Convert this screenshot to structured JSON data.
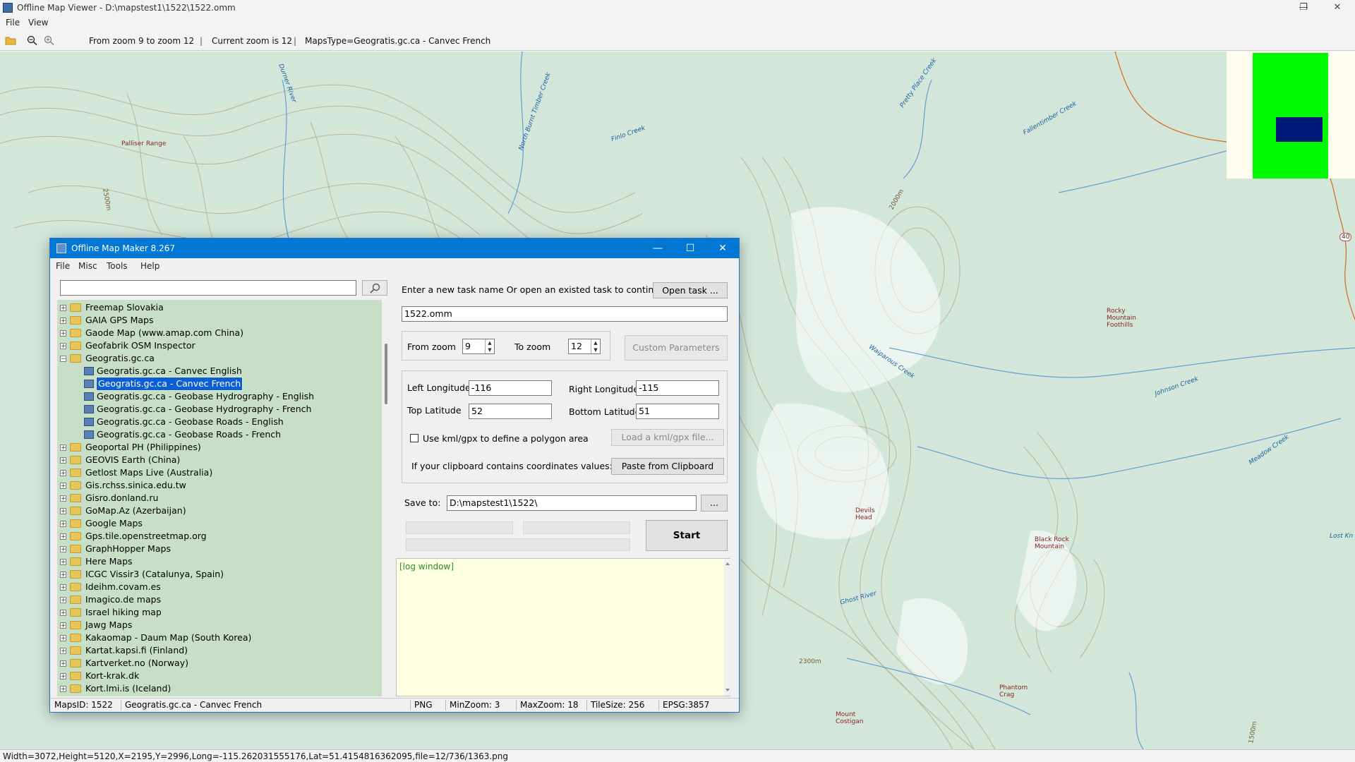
{
  "outer": {
    "title": "Offline Map Viewer - D:\\mapstest1\\1522\\1522.omm",
    "menu": [
      "File",
      "View"
    ],
    "toolbar": {
      "zoom_range": "From zoom 9 to zoom 12",
      "current_zoom": "Current zoom is 12",
      "maps_type": "MapsType=Geogratis.gc.ca - Canvec French"
    },
    "status": "Width=3072,Height=5120,X=2195,Y=2996,Long=-115.262031555176,Lat=51.4154816362095,file=12/736/1363.png"
  },
  "map": {
    "labels": [
      {
        "text": "Palliser Range",
        "kind": "brown"
      },
      {
        "text": "Durner River",
        "kind": "water"
      },
      {
        "text": "North Burnt Timber Creek",
        "kind": "water"
      },
      {
        "text": "Finlo Creek",
        "kind": "water"
      },
      {
        "text": "Pretty Place Creek",
        "kind": "water"
      },
      {
        "text": "Fallentimber Creek",
        "kind": "water"
      },
      {
        "text": "Rocky Mountain Foothills",
        "kind": "brown"
      },
      {
        "text": "Waiparous Creek",
        "kind": "water"
      },
      {
        "text": "Johnson Creek",
        "kind": "water"
      },
      {
        "text": "Devils Head",
        "kind": "brown"
      },
      {
        "text": "Black Rock Mountain",
        "kind": "brown"
      },
      {
        "text": "Ghost River",
        "kind": "water"
      },
      {
        "text": "Meadow Creek",
        "kind": "water"
      },
      {
        "text": "Phantom Crag",
        "kind": "brown"
      },
      {
        "text": "Mount Costigan",
        "kind": "brown"
      },
      {
        "text": "Lost Kn",
        "kind": "water"
      },
      {
        "text": "2500m",
        "kind": "contour"
      },
      {
        "text": "2000m",
        "kind": "contour"
      },
      {
        "text": "2300m",
        "kind": "contour"
      },
      {
        "text": "1500m",
        "kind": "contour"
      },
      {
        "text": "40",
        "kind": "water"
      }
    ]
  },
  "dialog": {
    "title": "Offline Map Maker 8.267",
    "menu": [
      "File",
      "Misc",
      "Tools",
      "Help"
    ],
    "search": {
      "value": "",
      "placeholder": ""
    },
    "tree": [
      {
        "label": "Freemap Slovakia",
        "level": 0,
        "type": "folder",
        "expanded": false
      },
      {
        "label": "GAIA GPS Maps",
        "level": 0,
        "type": "folder",
        "expanded": false
      },
      {
        "label": "Gaode Map (www.amap.com China)",
        "level": 0,
        "type": "folder",
        "expanded": false
      },
      {
        "label": "Geofabrik OSM Inspector",
        "level": 0,
        "type": "folder",
        "expanded": false
      },
      {
        "label": "Geogratis.gc.ca",
        "level": 0,
        "type": "folder",
        "expanded": true
      },
      {
        "label": "Geogratis.gc.ca - Canvec English",
        "level": 1,
        "type": "map"
      },
      {
        "label": "Geogratis.gc.ca - Canvec French",
        "level": 1,
        "type": "map",
        "selected": true
      },
      {
        "label": "Geogratis.gc.ca - Geobase Hydrography - English",
        "level": 1,
        "type": "map"
      },
      {
        "label": "Geogratis.gc.ca - Geobase Hydrography - French",
        "level": 1,
        "type": "map"
      },
      {
        "label": "Geogratis.gc.ca - Geobase Roads - English",
        "level": 1,
        "type": "map"
      },
      {
        "label": "Geogratis.gc.ca - Geobase Roads - French",
        "level": 1,
        "type": "map"
      },
      {
        "label": "Geoportal PH (Philippines)",
        "level": 0,
        "type": "folder",
        "expanded": false
      },
      {
        "label": "GEOVIS Earth (China)",
        "level": 0,
        "type": "folder",
        "expanded": false
      },
      {
        "label": "Getlost Maps Live (Australia)",
        "level": 0,
        "type": "folder",
        "expanded": false
      },
      {
        "label": "Gis.rchss.sinica.edu.tw",
        "level": 0,
        "type": "folder",
        "expanded": false
      },
      {
        "label": "Gisro.donland.ru",
        "level": 0,
        "type": "folder",
        "expanded": false
      },
      {
        "label": "GoMap.Az (Azerbaijan)",
        "level": 0,
        "type": "folder",
        "expanded": false
      },
      {
        "label": "Google Maps",
        "level": 0,
        "type": "folder",
        "expanded": false
      },
      {
        "label": "Gps.tile.openstreetmap.org",
        "level": 0,
        "type": "folder",
        "expanded": false
      },
      {
        "label": "GraphHopper Maps",
        "level": 0,
        "type": "folder",
        "expanded": false
      },
      {
        "label": "Here Maps",
        "level": 0,
        "type": "folder",
        "expanded": false
      },
      {
        "label": "ICGC Vissir3 (Catalunya, Spain)",
        "level": 0,
        "type": "folder",
        "expanded": false
      },
      {
        "label": "Ideihm.covam.es",
        "level": 0,
        "type": "folder",
        "expanded": false
      },
      {
        "label": "Imagico.de maps",
        "level": 0,
        "type": "folder",
        "expanded": false
      },
      {
        "label": "Israel hiking map",
        "level": 0,
        "type": "folder",
        "expanded": false
      },
      {
        "label": "Jawg Maps",
        "level": 0,
        "type": "folder",
        "expanded": false
      },
      {
        "label": "Kakaomap - Daum Map (South Korea)",
        "level": 0,
        "type": "folder",
        "expanded": false
      },
      {
        "label": "Kartat.kapsi.fi (Finland)",
        "level": 0,
        "type": "folder",
        "expanded": false
      },
      {
        "label": "Kartverket.no (Norway)",
        "level": 0,
        "type": "folder",
        "expanded": false
      },
      {
        "label": "Kort-krak.dk",
        "level": 0,
        "type": "folder",
        "expanded": false
      },
      {
        "label": "Kort.lmi.is (Iceland)",
        "level": 0,
        "type": "folder",
        "expanded": false
      }
    ],
    "task": {
      "prompt": "Enter a new task name Or open an existed task to continue:",
      "open_button": "Open task ...",
      "name_value": "1522.omm"
    },
    "zoom": {
      "from_label": "From zoom",
      "from_value": "9",
      "to_label": "To zoom",
      "to_value": "12",
      "custom_button": "Custom Parameters"
    },
    "coords": {
      "left_lon_label": "Left Longitude",
      "left_lon_value": "-116",
      "right_lon_label": "Right Longitude",
      "right_lon_value": "-115",
      "top_lat_label": "Top Latitude",
      "top_lat_value": "52",
      "bottom_lat_label": "Bottom Latitude",
      "bottom_lat_value": "51",
      "kml_checkbox_label": "Use kml/gpx to define a polygon area",
      "kml_checked": false,
      "kml_button": "Load a kml/gpx file...",
      "clipboard_label": "If your clipboard contains coordinates values:",
      "clipboard_button": "Paste from Clipboard"
    },
    "save": {
      "label": "Save to:",
      "value": "D:\\mapstest1\\1522\\",
      "browse_button": "...",
      "start_button": "Start"
    },
    "log": {
      "text": "[log window]"
    },
    "status": {
      "maps_id": "MapsID: 1522",
      "map_name": "Geogratis.gc.ca - Canvec French",
      "format": "PNG",
      "min_zoom": "MinZoom: 3",
      "max_zoom": "MaxZoom: 18",
      "tile_size": "TileSize: 256",
      "epsg": "EPSG:3857"
    }
  },
  "colors": {
    "accent": "#0078d4",
    "tree_bg": "#c6dfc6",
    "log_bg": "#ffffe1",
    "map_bg": "#d2e7da",
    "minimap_green": "#00f900",
    "minimap_view": "#001a7a"
  }
}
